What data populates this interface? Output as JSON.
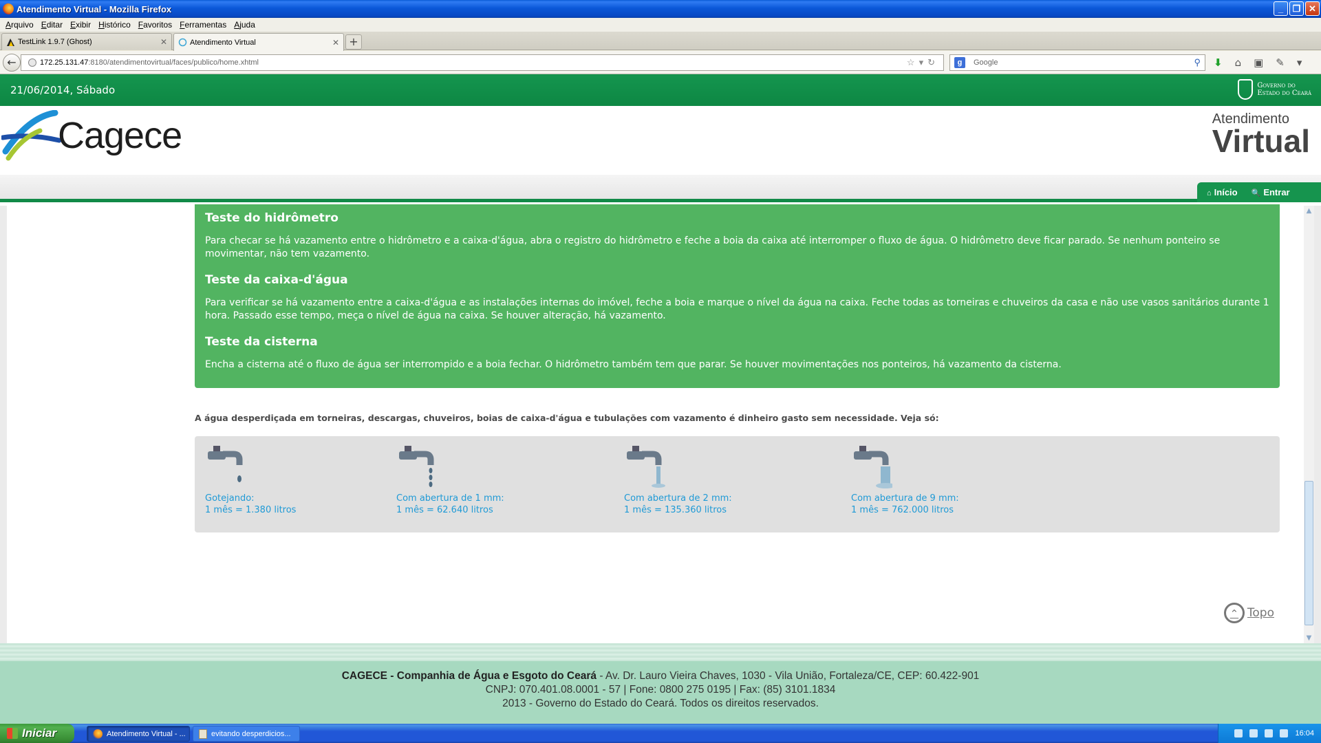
{
  "window": {
    "title": "Atendimento Virtual - Mozilla Firefox",
    "minimize": "_",
    "maximize": "❐",
    "close": "✕"
  },
  "menubar": {
    "items": [
      "Arquivo",
      "Editar",
      "Exibir",
      "Histórico",
      "Favoritos",
      "Ferramentas",
      "Ajuda"
    ]
  },
  "tabs": [
    {
      "label": "TestLink 1.9.7 (Ghost)",
      "active": false
    },
    {
      "label": "Atendimento Virtual",
      "active": true
    }
  ],
  "new_tab": "+",
  "navbar": {
    "back": "←",
    "url_host": "172.25.131.47",
    "url_rest": ":8180/atendimentovirtual/faces/publico/home.xhtml",
    "url_icons": "☆▾↻",
    "search_placeholder": "Google",
    "search_badge": "g",
    "search_icon": "⚲"
  },
  "site": {
    "date": "21/06/2014, Sábado",
    "gov_logo_line1": "Governo do",
    "gov_logo_line2": "Estado do Ceará",
    "brand": "Cagece",
    "av_small": "Atendimento",
    "av_big": "Virtual",
    "nav": {
      "home_icon": "⌂",
      "home_label": "Início",
      "login_icon": "🔍",
      "login_label": "Entrar"
    }
  },
  "tests": [
    {
      "title": "Teste do hidrômetro",
      "text": "Para checar se há vazamento entre o hidrômetro e a caixa-d'água, abra o registro do hidrômetro e feche a boia da caixa até interromper o fluxo de água. O hidrômetro deve ficar parado. Se nenhum ponteiro se movimentar, não tem vazamento."
    },
    {
      "title": "Teste da caixa-d'água",
      "text": "Para verificar se há vazamento entre a caixa-d'água e as instalações internas do imóvel, feche a boia e marque o nível da água na caixa. Feche todas as torneiras e chuveiros da casa e não use vasos sanitários durante 1 hora. Passado esse tempo, meça o nível de água na caixa. Se houver alteração, há vazamento."
    },
    {
      "title": "Teste da cisterna",
      "text": "Encha a cisterna até o fluxo de água ser interrompido e a boia fechar. O hidrômetro também tem que parar. Se houver movimentações nos ponteiros, há vazamento da cisterna."
    }
  ],
  "waste_intro": "A água desperdiçada em torneiras, descargas, chuveiros, boias de caixa-d'água e tubulações com vazamento é dinheiro gasto sem necessidade. Veja só:",
  "faucets": [
    {
      "label": "Gotejando:",
      "value": "1 mês = 1.380 litros",
      "icon": "faucet-dripping-icon"
    },
    {
      "label": "Com abertura de 1 mm:",
      "value": "1 mês = 62.640 litros",
      "icon": "faucet-1mm-icon"
    },
    {
      "label": "Com abertura de 2 mm:",
      "value": "1 mês = 135.360 litros",
      "icon": "faucet-2mm-icon"
    },
    {
      "label": "Com abertura de 9 mm:",
      "value": "1 mês = 762.000 litros",
      "icon": "faucet-9mm-icon"
    }
  ],
  "topo": {
    "icon": "⌃",
    "label": "Topo"
  },
  "footer": {
    "company": "CAGECE - Companhia de Água e Esgoto do Ceará",
    "address": " - Av. Dr. Lauro Vieira Chaves, 1030 - Vila União, Fortaleza/CE, CEP: 60.422-901",
    "contacts": "CNPJ: 070.401.08.0001 - 57 | Fone: 0800 275 0195 | Fax: (85) 3101.1834",
    "copyright": "2013 - Governo do Estado do Ceará. Todos os direitos reservados."
  },
  "taskbar": {
    "start": "Iniciar",
    "items": [
      {
        "label": "Atendimento Virtual - ...",
        "active": true
      },
      {
        "label": "evitando desperdicios...",
        "active": false
      }
    ],
    "clock": "16:04"
  },
  "colors": {
    "brand_green": "#16944e",
    "box_green": "#52b461",
    "faucet_label": "#1f9ad6"
  }
}
